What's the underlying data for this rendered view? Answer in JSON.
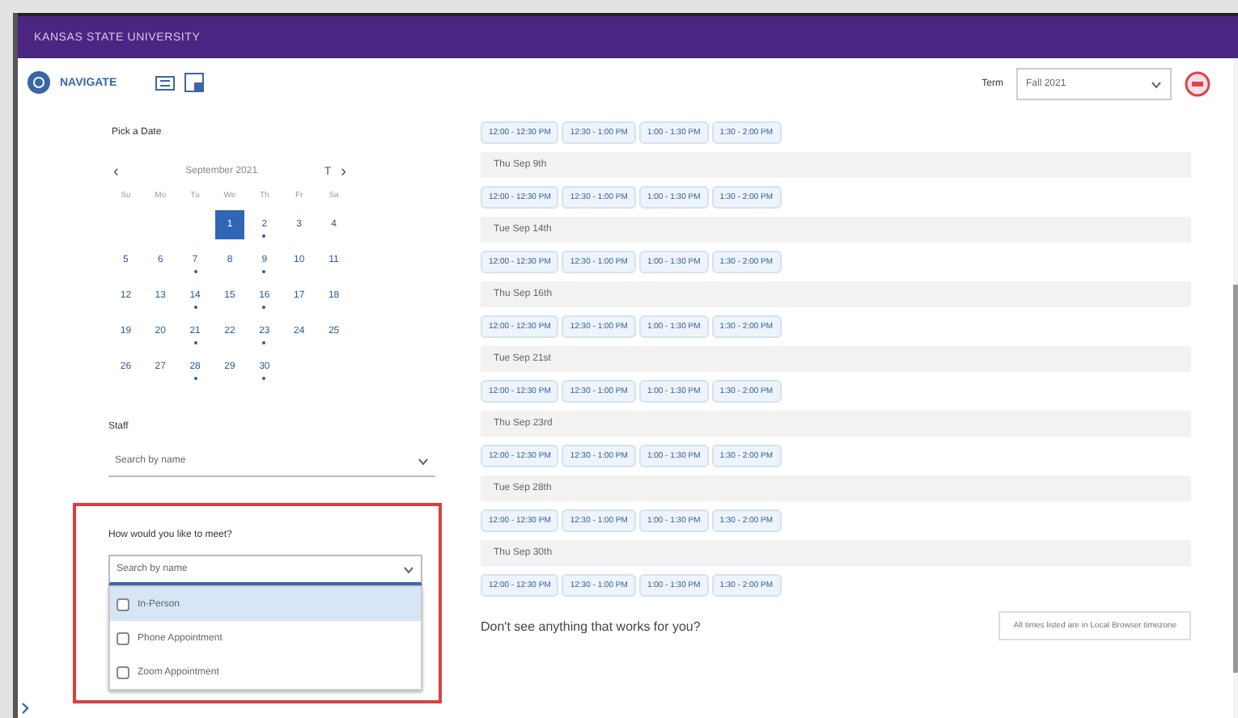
{
  "header": {
    "title": "KANSAS STATE UNIVERSITY"
  },
  "nav": {
    "brand": "NAVIGATE"
  },
  "term": {
    "label": "Term",
    "value": "Fall 2021"
  },
  "date_picker": {
    "label": "Pick a Date",
    "month": "September 2021",
    "prev": "‹",
    "today": "T",
    "next": "›",
    "weekdays": [
      "Su",
      "Mo",
      "Tu",
      "We",
      "Th",
      "Fr",
      "Sa"
    ],
    "weeks": [
      {
        "kind": "partial",
        "days": [
          {
            "day": "1",
            "selected": true,
            "available": false
          },
          {
            "day": "2",
            "selected": false,
            "available": true
          },
          {
            "day": "3",
            "selected": false,
            "available": false
          },
          {
            "day": "4",
            "selected": false,
            "available": false
          }
        ]
      },
      {
        "kind": "full",
        "days": [
          {
            "day": "5",
            "selected": false,
            "available": false
          },
          {
            "day": "6",
            "selected": false,
            "available": false
          },
          {
            "day": "7",
            "selected": false,
            "available": true
          },
          {
            "day": "8",
            "selected": false,
            "available": false
          },
          {
            "day": "9",
            "selected": false,
            "available": true
          },
          {
            "day": "10",
            "selected": false,
            "available": false
          },
          {
            "day": "11",
            "selected": false,
            "available": false
          }
        ]
      },
      {
        "kind": "full",
        "days": [
          {
            "day": "12",
            "selected": false,
            "available": false
          },
          {
            "day": "13",
            "selected": false,
            "available": false
          },
          {
            "day": "14",
            "selected": false,
            "available": true
          },
          {
            "day": "15",
            "selected": false,
            "available": false
          },
          {
            "day": "16",
            "selected": false,
            "available": true
          },
          {
            "day": "17",
            "selected": false,
            "available": false
          },
          {
            "day": "18",
            "selected": false,
            "available": false
          }
        ]
      },
      {
        "kind": "full",
        "days": [
          {
            "day": "19",
            "selected": false,
            "available": false
          },
          {
            "day": "20",
            "selected": false,
            "available": false
          },
          {
            "day": "21",
            "selected": false,
            "available": true
          },
          {
            "day": "22",
            "selected": false,
            "available": false
          },
          {
            "day": "23",
            "selected": false,
            "available": true
          },
          {
            "day": "24",
            "selected": false,
            "available": false
          },
          {
            "day": "25",
            "selected": false,
            "available": false
          }
        ]
      },
      {
        "kind": "partial_end",
        "days": [
          {
            "day": "26",
            "selected": false,
            "available": false
          },
          {
            "day": "27",
            "selected": false,
            "available": false
          },
          {
            "day": "28",
            "selected": false,
            "available": true
          },
          {
            "day": "29",
            "selected": false,
            "available": false
          },
          {
            "day": "30",
            "selected": false,
            "available": true
          }
        ]
      }
    ]
  },
  "staff": {
    "label": "Staff",
    "placeholder": "Search by name"
  },
  "meeting": {
    "label": "How would you like to meet?",
    "placeholder": "Search by name",
    "options": [
      {
        "label": "In-Person",
        "highlighted": true,
        "checked": false
      },
      {
        "label": "Phone Appointment",
        "highlighted": false,
        "checked": false
      },
      {
        "label": "Zoom Appointment",
        "highlighted": false,
        "checked": false
      }
    ]
  },
  "slot_groups": [
    {
      "slots": [
        "12:00 - 12:30 PM",
        "12:30 - 1:00 PM",
        "1:00 - 1:30 PM",
        "1:30 - 2:00 PM"
      ]
    },
    {
      "date": "Thu Sep 9th",
      "slots": [
        "12:00 - 12:30 PM",
        "12:30 - 1:00 PM",
        "1:00 - 1:30 PM",
        "1:30 - 2:00 PM"
      ]
    },
    {
      "date": "Tue Sep 14th",
      "slots": [
        "12:00 - 12:30 PM",
        "12:30 - 1:00 PM",
        "1:00 - 1:30 PM",
        "1:30 - 2:00 PM"
      ]
    },
    {
      "date": "Thu Sep 16th",
      "slots": [
        "12:00 - 12:30 PM",
        "12:30 - 1:00 PM",
        "1:00 - 1:30 PM",
        "1:30 - 2:00 PM"
      ]
    },
    {
      "date": "Tue Sep 21st",
      "slots": [
        "12:00 - 12:30 PM",
        "12:30 - 1:00 PM",
        "1:00 - 1:30 PM",
        "1:30 - 2:00 PM"
      ]
    },
    {
      "date": "Thu Sep 23rd",
      "slots": [
        "12:00 - 12:30 PM",
        "12:30 - 1:00 PM",
        "1:00 - 1:30 PM",
        "1:30 - 2:00 PM"
      ]
    },
    {
      "date": "Tue Sep 28th",
      "slots": [
        "12:00 - 12:30 PM",
        "12:30 - 1:00 PM",
        "1:00 - 1:30 PM",
        "1:30 - 2:00 PM"
      ]
    },
    {
      "date": "Thu Sep 30th",
      "slots": [
        "12:00 - 12:30 PM",
        "12:30 - 1:00 PM",
        "1:00 - 1:30 PM",
        "1:30 - 2:00 PM"
      ]
    }
  ],
  "footer": {
    "question": "Don't see anything that works for you?",
    "timezone_note": "All times listed are in Local Browser timezone"
  }
}
